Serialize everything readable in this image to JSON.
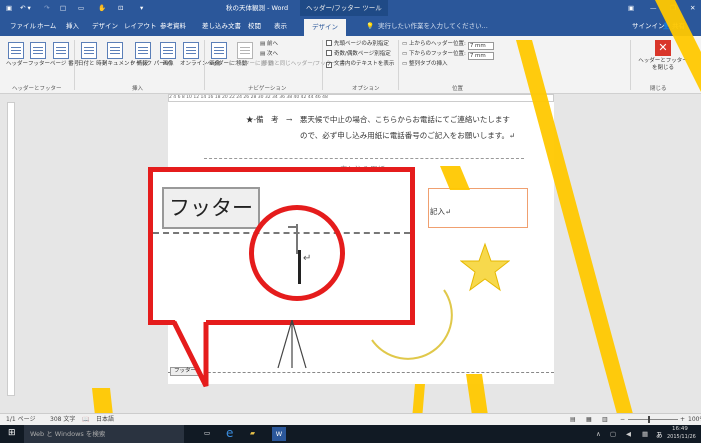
{
  "window": {
    "title": "秋の天体観測 - Word",
    "context_tab_group": "ヘッダー/フッター ツール",
    "sign_in": "サインイン",
    "share": "共有",
    "qat_icons": [
      "save-icon",
      "undo-icon",
      "redo-icon",
      "new-doc-icon",
      "open-icon",
      "touch-mode-icon",
      "print-preview-icon",
      "customize-qat-icon"
    ]
  },
  "tabs": [
    "ファイル",
    "ホーム",
    "挿入",
    "デザイン",
    "レイアウト",
    "参考資料",
    "差し込み文書",
    "校閲",
    "表示"
  ],
  "active_tab": "デザイン",
  "tell_me": "実行したい作業を入力してください...",
  "ribbon": {
    "hf_buttons": [
      "ヘッダー",
      "フッター",
      "ページ 番号"
    ],
    "hf_group": "ヘッダーとフッター",
    "insert_buttons": [
      "日付と 時刻",
      "ドキュメント 情報",
      "クイック パーツ",
      "画像",
      "オンライン 画像"
    ],
    "insert_group": "挿入",
    "nav_buttons": [
      "ヘッダーに 移動",
      "フッターに 移動"
    ],
    "nav_small": [
      "前へ",
      "次へ",
      "前と同じヘッダー/フッター"
    ],
    "nav_group": "ナビゲーション",
    "options": [
      {
        "label": "先頭ページのみ別指定",
        "checked": false
      },
      {
        "label": "奇数/偶数ページ別指定",
        "checked": false
      },
      {
        "label": "文書内のテキストを表示",
        "checked": true
      }
    ],
    "options_group": "オプション",
    "position": [
      {
        "label": "上からのヘッダー位置:",
        "value": "7 mm"
      },
      {
        "label": "下からのフッター位置:",
        "value": "7 mm"
      },
      {
        "label": "整列タブの挿入"
      }
    ],
    "position_group": "位置",
    "close_label": "ヘッダーとフッター を閉じる",
    "close_group": "閉じる"
  },
  "ruler_marks": "2 4 6 8 10 12 14 16 18 20 22 24 26 28 30 32 34 36 38 40 42 44 46 48",
  "document": {
    "line1": "★-備　考　→　悪天候で中止の場合、こちらからお電話にてご連絡いたします",
    "line2": "ので、必ず申し込み用紙に電話番号のご記入をお願いします。↵",
    "partial1": "申し込み用紙",
    "partial2": "記入↵",
    "footer_small_label": "フッター"
  },
  "callout": {
    "footer_label": "フッター"
  },
  "statusbar": {
    "page": "1/1 ページ",
    "words": "308 文字",
    "lang": "日本語",
    "zoom": "100%"
  },
  "taskbar": {
    "search": "Web と Windows を検索",
    "time": "16:49",
    "date": "2015/11/26",
    "ime": "あ"
  },
  "colors": {
    "title_blue": "#2b579a",
    "callout_red": "#e51c1c",
    "annotation_yellow": "#ffc800"
  }
}
